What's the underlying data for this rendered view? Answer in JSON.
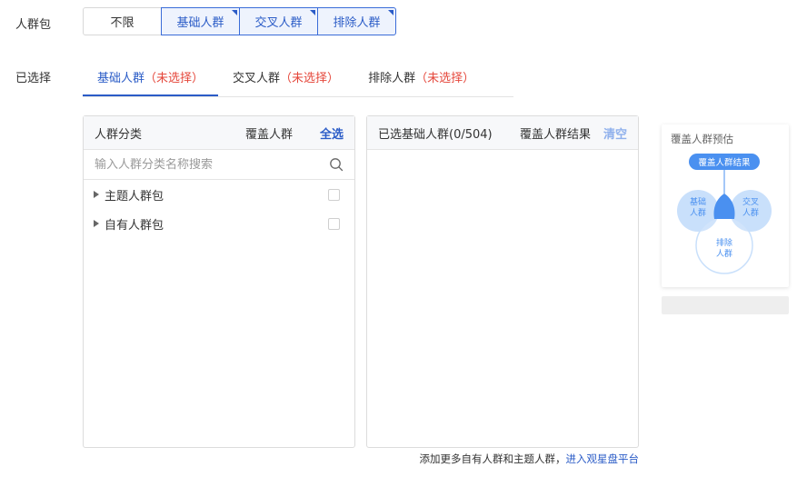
{
  "crowd_pack": {
    "label": "人群包",
    "options": [
      {
        "label": "不限",
        "selected": false
      },
      {
        "label": "基础人群",
        "selected": true
      },
      {
        "label": "交叉人群",
        "selected": true
      },
      {
        "label": "排除人群",
        "selected": true
      }
    ]
  },
  "selected_section": {
    "label": "已选择",
    "tabs": [
      {
        "label": "基础人群",
        "hint": "（未选择）",
        "active": true
      },
      {
        "label": "交叉人群",
        "hint": "（未选择）",
        "active": false
      },
      {
        "label": "排除人群",
        "hint": "（未选择）",
        "active": false
      }
    ]
  },
  "left_panel": {
    "col1": "人群分类",
    "col2": "覆盖人群",
    "select_all": "全选",
    "search_placeholder": "输入人群分类名称搜索",
    "items": [
      {
        "label": "主题人群包"
      },
      {
        "label": "自有人群包"
      }
    ]
  },
  "right_panel": {
    "title": "已选基础人群(0/504)",
    "col2": "覆盖人群结果",
    "clear": "清空"
  },
  "footer": {
    "text": "添加更多自有人群和主题人群，",
    "link": "进入观星盘平台"
  },
  "estimate": {
    "title": "覆盖人群预估",
    "result_label": "覆盖人群结果",
    "circle_base": "基础人群",
    "circle_cross": "交叉人群",
    "circle_exclude": "排除人群",
    "colors": {
      "accent": "#2b5cc7",
      "circle": "#c9e0fb",
      "intersection": "#4a90f0"
    }
  }
}
